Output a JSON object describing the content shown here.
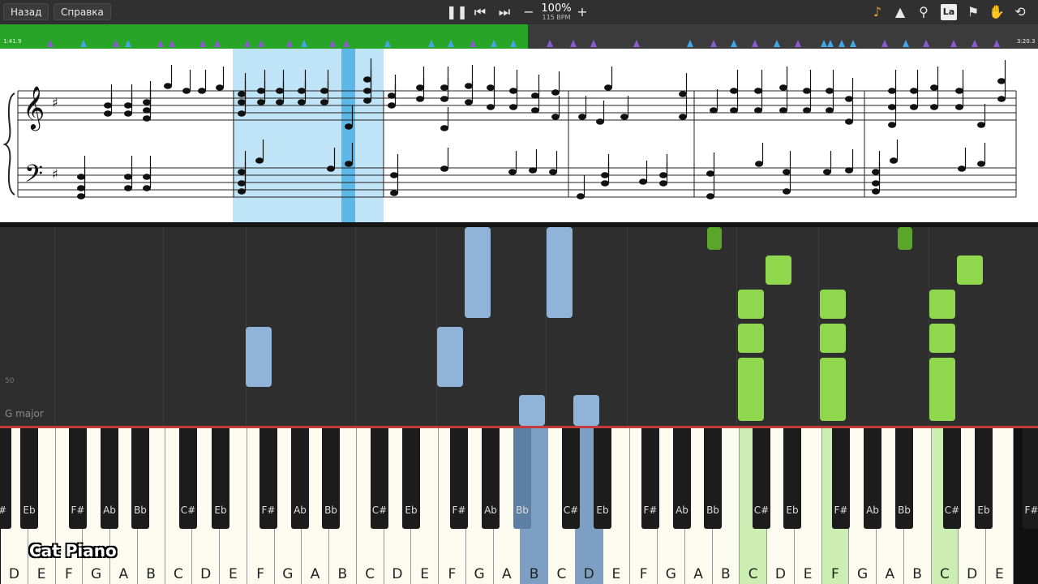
{
  "toolbar": {
    "back_label": "Назад",
    "help_label": "Справка",
    "speed_percent": "100%",
    "speed_bpm": "115 BPM",
    "key_badge": "La"
  },
  "timeline": {
    "current_time": "1:41.9",
    "total_time": "3:20.3",
    "progress_fraction": 0.51
  },
  "roll": {
    "marker_50": "50",
    "key_signature": "G major"
  },
  "keyboard": {
    "white_keys": [
      "D",
      "E",
      "F",
      "G",
      "A",
      "B",
      "C",
      "D",
      "E",
      "F",
      "G",
      "A",
      "B",
      "C",
      "D",
      "E",
      "F",
      "G",
      "A",
      "B",
      "C",
      "D",
      "E",
      "F",
      "G",
      "A",
      "B",
      "C",
      "D",
      "E",
      "F",
      "G",
      "A",
      "B",
      "C",
      "D",
      "E"
    ],
    "black_keys": [
      "#",
      "Eb",
      "F#",
      "Ab",
      "Bb",
      "C#",
      "Eb",
      "F#",
      "Ab",
      "Bb",
      "C#",
      "Eb",
      "F#",
      "Ab",
      "Bb",
      "C#",
      "Eb",
      "F#",
      "Ab",
      "Bb",
      "C#",
      "Eb",
      "F#",
      "Ab",
      "Bb",
      "C#",
      "Eb",
      "F#"
    ]
  },
  "watermark": "Cat Piano",
  "colors": {
    "played_track": "#27a527",
    "left_hand": "#8fb3d9",
    "right_hand": "#8fd84e",
    "now_line": "#c73a3a"
  }
}
